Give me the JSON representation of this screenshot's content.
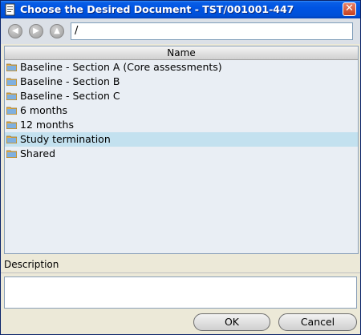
{
  "window": {
    "title": "Choose the Desired Document - TST/001001-447",
    "close_glyph": "✕"
  },
  "nav": {
    "back_glyph": "◀",
    "forward_glyph": "▶",
    "up_glyph": "▲",
    "path": "/"
  },
  "list": {
    "column_header": "Name",
    "items": [
      {
        "label": "Baseline - Section A (Core assessments)",
        "icon": "folder-icon"
      },
      {
        "label": "Baseline - Section B",
        "icon": "folder-icon"
      },
      {
        "label": "Baseline - Section C",
        "icon": "folder-icon"
      },
      {
        "label": "6 months",
        "icon": "folder-icon"
      },
      {
        "label": "12 months",
        "icon": "folder-icon"
      },
      {
        "label": "Study termination",
        "icon": "folder-icon",
        "selected": true
      },
      {
        "label": "Shared",
        "icon": "folder-icon"
      }
    ]
  },
  "description": {
    "label": "Description",
    "value": ""
  },
  "buttons": {
    "ok": "OK",
    "cancel": "Cancel"
  },
  "colors": {
    "titlebar": "#0054e3",
    "selection": "#c3e1ef",
    "window_bg": "#ece9d8",
    "list_bg": "#e9eef4"
  }
}
